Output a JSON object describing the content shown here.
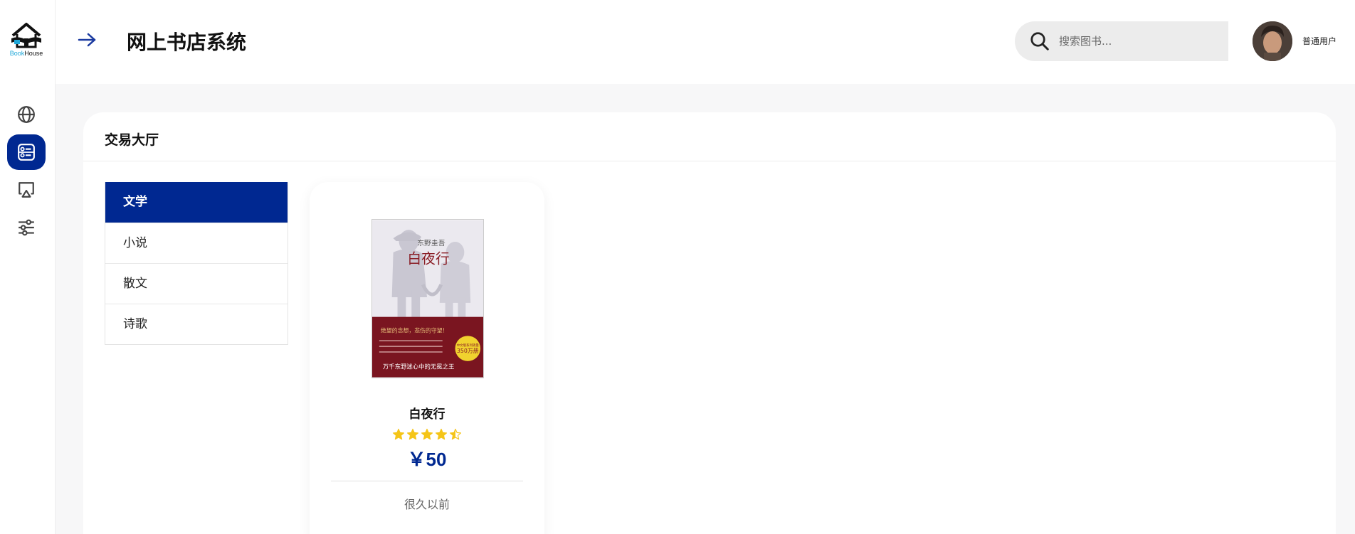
{
  "app": {
    "logo_text_a": "Book",
    "logo_text_b": "House",
    "title": "网上书店系统"
  },
  "sidebar": {
    "items": [
      {
        "icon": "globe-icon",
        "active": false
      },
      {
        "icon": "dashboard-icon",
        "active": true
      },
      {
        "icon": "airplay-icon",
        "active": false
      },
      {
        "icon": "sliders-icon",
        "active": false
      }
    ]
  },
  "search": {
    "placeholder": "搜索图书..."
  },
  "user": {
    "role": "普通用户"
  },
  "section": {
    "title": "交易大厅"
  },
  "categories": [
    {
      "label": "文学",
      "active": true
    },
    {
      "label": "小说",
      "active": false
    },
    {
      "label": "散文",
      "active": false
    },
    {
      "label": "诗歌",
      "active": false
    }
  ],
  "book": {
    "title": "白夜行",
    "rating": 4.5,
    "rating_max": 5,
    "price": "￥50",
    "time": "很久以前",
    "cover": {
      "author": "东野圭吾",
      "title": "白夜行",
      "tagline": "绝望的念想，悲伤的守望！",
      "badge_line1": "中文版系列销量",
      "badge_line2": "350万册",
      "bottom": "万千东野迷心中的无冕之王"
    }
  },
  "colors": {
    "accent": "#002891",
    "star": "#f5c518",
    "cover_red": "#7a1520"
  }
}
